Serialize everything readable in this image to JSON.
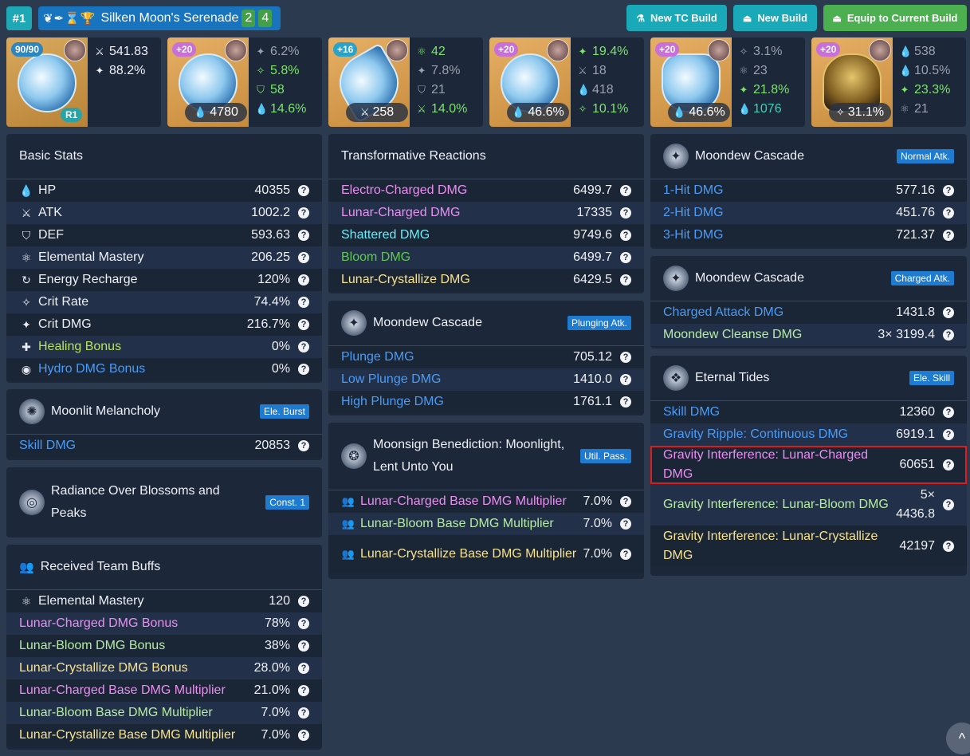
{
  "header": {
    "rank": "#1",
    "set_icons": "❦✒⌛🏆",
    "build_name": "Silken Moon's Serenade",
    "set_count_1": "2",
    "set_count_2": "4",
    "new_tc_build": "New TC Build",
    "new_build": "New Build",
    "equip": "Equip to Current Build"
  },
  "equipment": [
    {
      "type": "weapon",
      "level": "90/90",
      "refine": "R1",
      "subs": [
        {
          "icon": "atk-icon",
          "value": "541.83",
          "color": "white"
        },
        {
          "icon": "crit-dmg-icon",
          "value": "88.2%",
          "color": "white"
        }
      ]
    },
    {
      "type": "flower",
      "level": "+20",
      "main": "4780",
      "main_icon": "hp-icon",
      "subs": [
        {
          "icon": "crit-dmg-icon",
          "value": "6.2%",
          "color": "gray"
        },
        {
          "icon": "crit-rate-icon",
          "value": "5.8%",
          "color": "green"
        },
        {
          "icon": "def-icon",
          "value": "58",
          "color": "green"
        },
        {
          "icon": "hp-icon",
          "value": "14.6%",
          "color": "green"
        }
      ]
    },
    {
      "type": "plume",
      "level": "+16",
      "main": "258",
      "main_icon": "atk-icon",
      "subs": [
        {
          "icon": "em-icon",
          "value": "42",
          "color": "green"
        },
        {
          "icon": "crit-dmg-icon",
          "value": "7.8%",
          "color": "gray"
        },
        {
          "icon": "def-icon",
          "value": "21",
          "color": "gray"
        },
        {
          "icon": "atk-icon",
          "value": "14.0%",
          "color": "green"
        }
      ]
    },
    {
      "type": "sands",
      "level": "+20",
      "main": "46.6%",
      "main_icon": "hp-icon",
      "subs": [
        {
          "icon": "crit-dmg-icon",
          "value": "19.4%",
          "color": "green"
        },
        {
          "icon": "atk-icon",
          "value": "18",
          "color": "gray"
        },
        {
          "icon": "hp-icon",
          "value": "418",
          "color": "gray"
        },
        {
          "icon": "crit-rate-icon",
          "value": "10.1%",
          "color": "green"
        }
      ]
    },
    {
      "type": "goblet",
      "level": "+20",
      "main": "46.6%",
      "main_icon": "hp-icon",
      "subs": [
        {
          "icon": "crit-rate-icon",
          "value": "3.1%",
          "color": "gray"
        },
        {
          "icon": "em-icon",
          "value": "23",
          "color": "gray"
        },
        {
          "icon": "crit-dmg-icon",
          "value": "21.8%",
          "color": "green"
        },
        {
          "icon": "hp-icon",
          "value": "1076",
          "color": "teal"
        }
      ]
    },
    {
      "type": "circlet",
      "level": "+20",
      "main": "31.1%",
      "main_icon": "crit-rate-icon",
      "subs": [
        {
          "icon": "hp-icon",
          "value": "538",
          "color": "gray"
        },
        {
          "icon": "hp-icon",
          "value": "10.5%",
          "color": "gray"
        },
        {
          "icon": "crit-dmg-icon",
          "value": "23.3%",
          "color": "green"
        },
        {
          "icon": "em-icon",
          "value": "21",
          "color": "gray"
        }
      ]
    }
  ],
  "basic_stats": {
    "title": "Basic Stats",
    "rows": [
      {
        "icon": "💧",
        "label": "HP",
        "value": "40355",
        "color": "white"
      },
      {
        "icon": "⚔",
        "label": "ATK",
        "value": "1002.2",
        "color": "white"
      },
      {
        "icon": "⛉",
        "label": "DEF",
        "value": "593.63",
        "color": "white"
      },
      {
        "icon": "⚛",
        "label": "Elemental Mastery",
        "value": "206.25",
        "color": "white"
      },
      {
        "icon": "↻",
        "label": "Energy Recharge",
        "value": "120%",
        "color": "white"
      },
      {
        "icon": "✧",
        "label": "Crit Rate",
        "value": "74.4%",
        "color": "white"
      },
      {
        "icon": "✦",
        "label": "Crit DMG",
        "value": "216.7%",
        "color": "white"
      },
      {
        "icon": "✚",
        "label": "Healing Bonus",
        "value": "0%",
        "color": "lime"
      },
      {
        "icon": "◉",
        "label": "Hydro DMG Bonus",
        "value": "0%",
        "color": "blue"
      }
    ]
  },
  "burst": {
    "title": "Moonlit Melancholy",
    "tag": "Ele. Burst",
    "rows": [
      {
        "label": "Skill DMG",
        "value": "20853",
        "color": "blue"
      }
    ]
  },
  "const1": {
    "title_1": "Radiance Over Blossoms and",
    "title_2": "Peaks",
    "tag": "Const. 1"
  },
  "team_buffs": {
    "title": "Received Team Buffs",
    "rows": [
      {
        "icon": "⚛",
        "label": "Elemental Mastery",
        "value": "120",
        "color": "white"
      },
      {
        "label": "Lunar-Charged DMG Bonus",
        "value": "78%",
        "color": "pink"
      },
      {
        "label": "Lunar-Bloom DMG Bonus",
        "value": "38%",
        "color": "lgreen"
      },
      {
        "label": "Lunar-Crystallize DMG Bonus",
        "value": "28.0%",
        "color": "yellow"
      },
      {
        "label": "Lunar-Charged Base DMG Multiplier",
        "value": "21.0%",
        "color": "pink"
      },
      {
        "label": "Lunar-Bloom Base DMG Multiplier",
        "value": "7.0%",
        "color": "lgreen"
      },
      {
        "label": "Lunar-Crystallize Base DMG Multiplier",
        "value": "7.0%",
        "color": "yellow"
      }
    ]
  },
  "transformative": {
    "title": "Transformative Reactions",
    "rows": [
      {
        "label": "Electro-Charged DMG",
        "value": "6499.7",
        "color": "pink"
      },
      {
        "label": "Lunar-Charged DMG",
        "value": "17335",
        "color": "pink"
      },
      {
        "label": "Shattered DMG",
        "value": "9749.6",
        "color": "cyan"
      },
      {
        "label": "Bloom DMG",
        "value": "6499.7",
        "color": "green"
      },
      {
        "label": "Lunar-Crystallize DMG",
        "value": "6429.5",
        "color": "yellow"
      }
    ]
  },
  "plunge": {
    "title": "Moondew Cascade",
    "tag": "Plunging Atk.",
    "rows": [
      {
        "label": "Plunge DMG",
        "value": "705.12",
        "color": "blue"
      },
      {
        "label": "Low Plunge DMG",
        "value": "1410.0",
        "color": "blue"
      },
      {
        "label": "High Plunge DMG",
        "value": "1761.1",
        "color": "blue"
      }
    ]
  },
  "moonsign": {
    "title_1": "Moonsign Benediction: Moonlight,",
    "title_2": "Lent Unto You",
    "tag": "Util. Pass.",
    "rows": [
      {
        "label": "Lunar-Charged Base DMG Multiplier",
        "value": "7.0%",
        "color": "pink"
      },
      {
        "label": "Lunar-Bloom Base DMG Multiplier",
        "value": "7.0%",
        "color": "lgreen"
      },
      {
        "label": "Lunar-Crystallize Base DMG Multiplier",
        "value": "7.0%",
        "color": "yellow"
      }
    ]
  },
  "normal": {
    "title": "Moondew Cascade",
    "tag": "Normal Atk.",
    "rows": [
      {
        "label": "1-Hit DMG",
        "value": "577.16",
        "color": "blue"
      },
      {
        "label": "2-Hit DMG",
        "value": "451.76",
        "color": "blue"
      },
      {
        "label": "3-Hit DMG",
        "value": "721.37",
        "color": "blue"
      }
    ]
  },
  "charged": {
    "title": "Moondew Cascade",
    "tag": "Charged Atk.",
    "rows": [
      {
        "label": "Charged Attack DMG",
        "value": "1431.8",
        "color": "blue"
      },
      {
        "label": "Moondew Cleanse DMG",
        "value": "3× 3199.4",
        "color": "lgreen"
      }
    ]
  },
  "skill": {
    "title": "Eternal Tides",
    "tag": "Ele. Skill",
    "rows": [
      {
        "label": "Skill DMG",
        "value": "12360",
        "color": "blue"
      },
      {
        "label": "Gravity Ripple: Continuous DMG",
        "value": "6919.1",
        "color": "blue"
      },
      {
        "label": "Gravity Interference: Lunar-Charged DMG",
        "value": "60651",
        "color": "pink"
      },
      {
        "label": "Gravity Interference: Lunar-Bloom DMG",
        "value": "5× 4436.8",
        "color": "lgreen"
      },
      {
        "label": "Gravity Interference: Lunar-Crystallize DMG",
        "value": "42197",
        "color": "yellow"
      }
    ]
  },
  "question_mark": "?",
  "scroll_icon": "^"
}
